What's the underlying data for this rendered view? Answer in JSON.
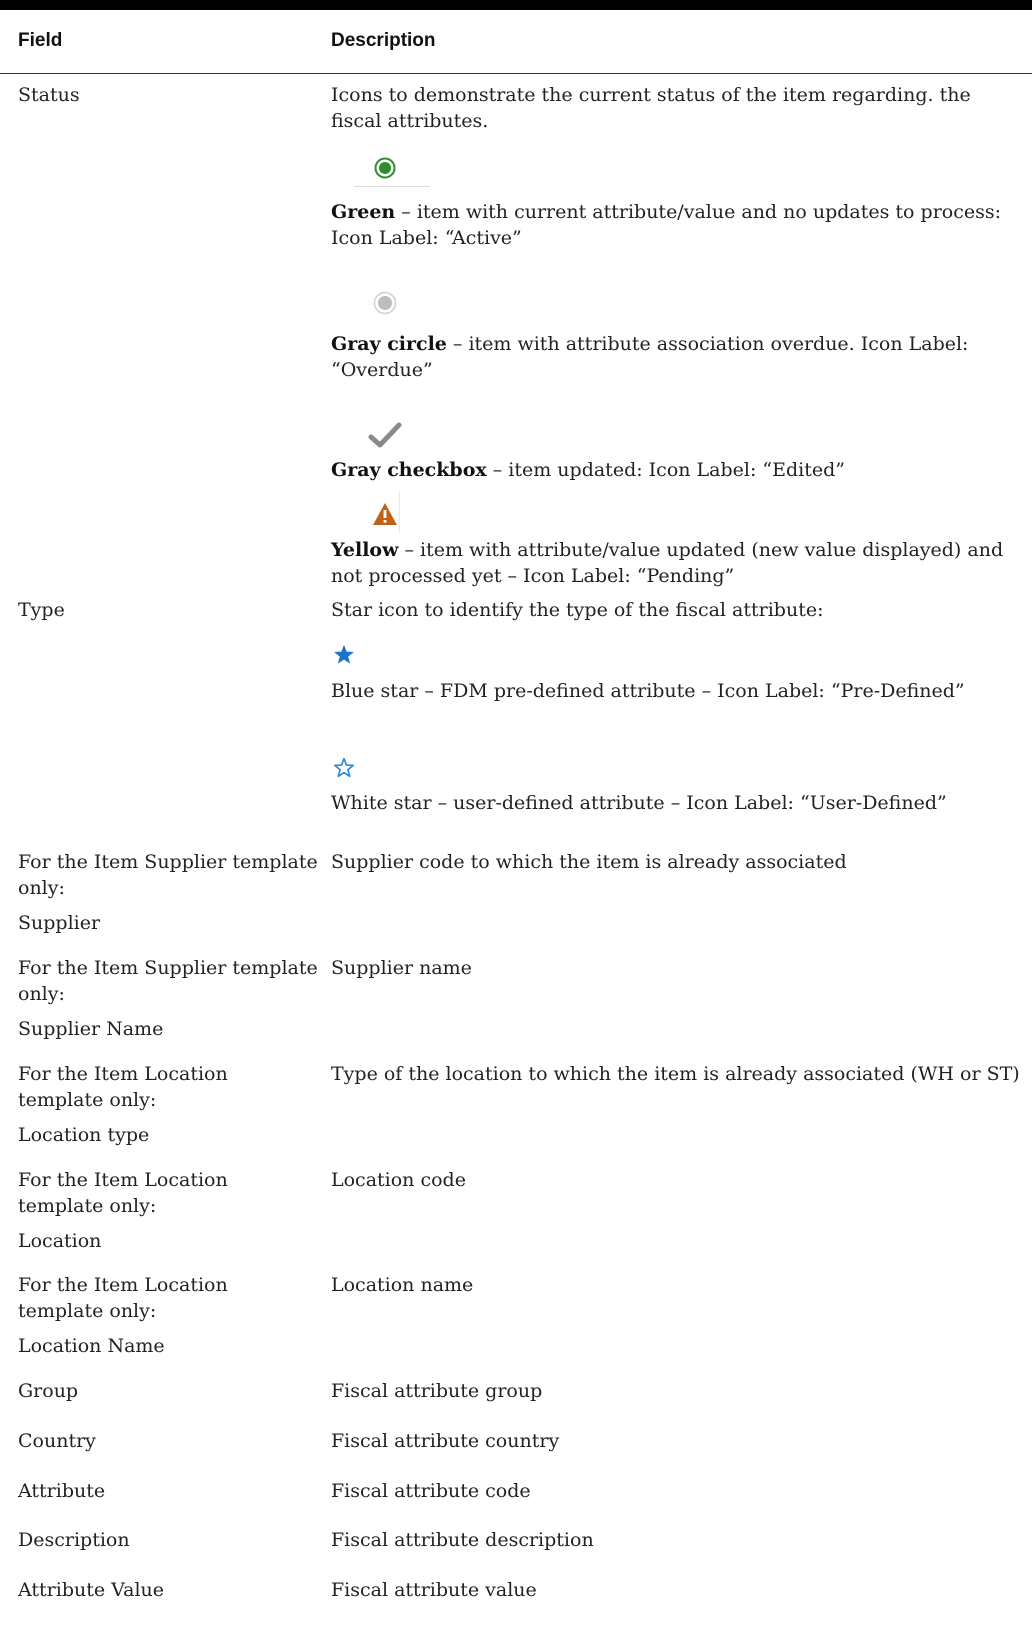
{
  "table": {
    "headers": {
      "field": "Field",
      "description": "Description"
    },
    "status": {
      "field": "Status",
      "intro": "Icons to demonstrate the current status of the item regarding. the fiscal attributes.",
      "green": {
        "bold": "Green",
        "rest": " – item with current attribute/value and no updates to process: Icon Label: “Active”",
        "icon": "green-circle-icon",
        "color": "#2e8b2e"
      },
      "gray_circle": {
        "bold": "Gray circle",
        "rest": " – item with attribute association overdue. Icon Label: “Overdue”",
        "icon": "gray-circle-icon",
        "color": "#bdbdbd"
      },
      "gray_check": {
        "bold": "Gray checkbox",
        "rest": " – item updated: Icon Label: “Edited”",
        "icon": "checkmark-icon",
        "color": "#8a8a8a"
      },
      "yellow": {
        "bold": "Yellow",
        "rest": " – item with attribute/value updated (new value displayed) and not processed yet – Icon Label: “Pending”",
        "icon": "warning-icon",
        "color": "#c0631a"
      }
    },
    "type": {
      "field": "Type",
      "intro": "Star icon to identify the type of the fiscal attribute:",
      "blue_star": {
        "text": "Blue star – FDM pre-defined attribute – Icon Label: “Pre-Defined”",
        "icon": "blue-star-icon",
        "color": "#1d72c9"
      },
      "white_star": {
        "text": "White star – user-defined attribute – Icon Label: “User-Defined”",
        "icon": "white-star-icon",
        "color": "#2b8ad6"
      }
    },
    "rows": [
      {
        "field_note": "For the Item Supplier template only:",
        "field": "Supplier",
        "description": "Supplier code to which the item is already associated"
      },
      {
        "field_note": "For the Item Supplier template only:",
        "field": "Supplier Name",
        "description": "Supplier name"
      },
      {
        "field_note": "For the Item Location template only:",
        "field": "Location type",
        "description": "Type of the location to which the item is already associated (WH or ST)"
      },
      {
        "field_note": "For the Item Location template only:",
        "field": "Location",
        "description": "Location code"
      },
      {
        "field_note": "For the Item Location template only:",
        "field": "Location Name",
        "description": "Location name"
      },
      {
        "field": "Group",
        "description": "Fiscal attribute group"
      },
      {
        "field": "Country",
        "description": "Fiscal attribute country"
      },
      {
        "field": "Attribute",
        "description": "Fiscal attribute code"
      },
      {
        "field": "Description",
        "description": "Fiscal attribute description"
      },
      {
        "field": "Attribute Value",
        "description": "Fiscal attribute value"
      }
    ]
  }
}
